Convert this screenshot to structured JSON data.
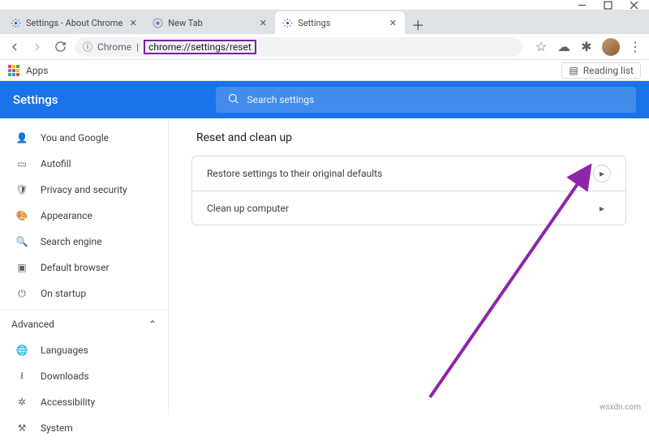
{
  "window": {
    "minimize": "–",
    "maximize": "☐",
    "close": "✕"
  },
  "tabs": [
    {
      "title": "Settings - About Chrome",
      "active": false,
      "icon": "gear-blue"
    },
    {
      "title": "New Tab",
      "active": false,
      "icon": "chrome"
    },
    {
      "title": "Settings",
      "active": true,
      "icon": "gear-blue"
    }
  ],
  "toolbar": {
    "site_label": "Chrome",
    "url": "chrome://settings/reset"
  },
  "bookmarks": {
    "apps_label": "Apps",
    "reading_list": "Reading list"
  },
  "header": {
    "title": "Settings",
    "search_placeholder": "Search settings"
  },
  "sidebar": {
    "items": [
      {
        "icon": "person",
        "label": "You and Google"
      },
      {
        "icon": "autofill",
        "label": "Autofill"
      },
      {
        "icon": "shield",
        "label": "Privacy and security"
      },
      {
        "icon": "palette",
        "label": "Appearance"
      },
      {
        "icon": "search",
        "label": "Search engine"
      },
      {
        "icon": "browser",
        "label": "Default browser"
      },
      {
        "icon": "power",
        "label": "On startup"
      }
    ],
    "section": "Advanced",
    "advanced_items": [
      {
        "icon": "globe",
        "label": "Languages"
      },
      {
        "icon": "download",
        "label": "Downloads"
      },
      {
        "icon": "accessibility",
        "label": "Accessibility"
      },
      {
        "icon": "system",
        "label": "System"
      }
    ]
  },
  "main": {
    "title": "Reset and clean up",
    "rows": [
      {
        "label": "Restore settings to their original defaults"
      },
      {
        "label": "Clean up computer"
      }
    ]
  },
  "watermark": "wsxdn.com"
}
